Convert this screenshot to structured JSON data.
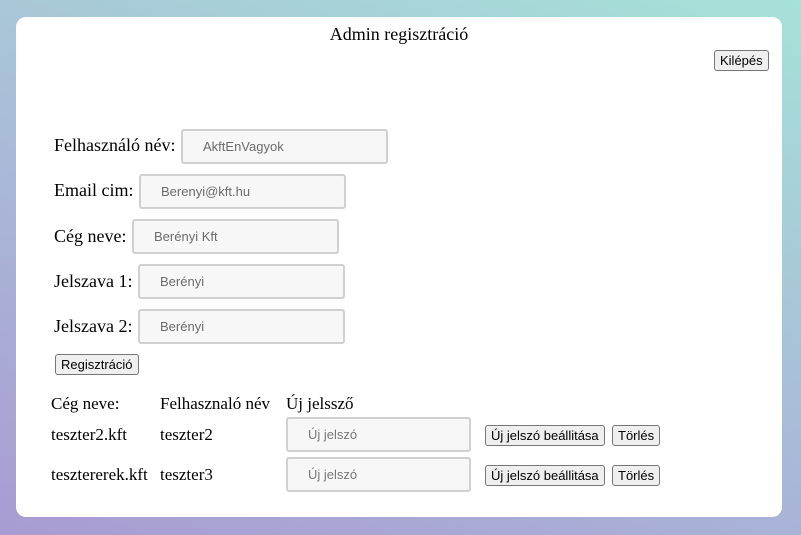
{
  "page": {
    "title": "Admin regisztráció",
    "logout_label": "Kilépés"
  },
  "form": {
    "username": {
      "label": "Felhasználó név:",
      "value": "AkftEnVagyok"
    },
    "email": {
      "label": "Email cim:",
      "value": "Berenyi@kft.hu"
    },
    "company": {
      "label": "Cég neve:",
      "value": "Berényi Kft"
    },
    "password1": {
      "label": "Jelszava 1:",
      "value": "Berényi"
    },
    "password2": {
      "label": "Jelszava 2:",
      "value": "Berényi"
    },
    "register_label": "Regisztráció"
  },
  "table": {
    "headers": [
      "Cég neve:",
      "Felhasznaló név",
      "Új jelssző"
    ],
    "rows": [
      {
        "company": "teszter2.kft",
        "user": "teszter2",
        "new_password_placeholder": "Új jelszó",
        "set_label": "Új jelszó beállitása",
        "delete_label": "Törlés"
      },
      {
        "company": "tesztererek.kft",
        "user": "teszter3",
        "new_password_placeholder": "Új jelszó",
        "set_label": "Új jelszó beállitása",
        "delete_label": "Törlés"
      }
    ]
  }
}
